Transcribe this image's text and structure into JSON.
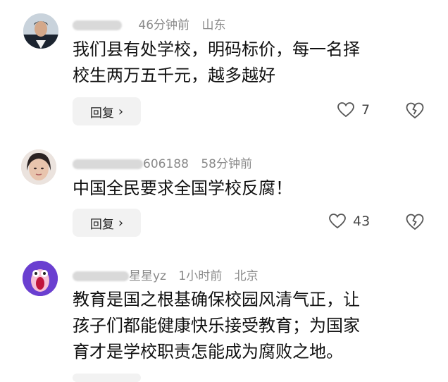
{
  "comments": [
    {
      "username": "",
      "time": "46分钟前",
      "location": "山东",
      "text_lines": [
        "我们县有处学校，明码标价，每一名择",
        "校生两万五千元，越多越好"
      ],
      "reply_label": "回复",
      "like_count": "7"
    },
    {
      "username": "606188",
      "time": "58分钟前",
      "location": "",
      "text_lines": [
        "中国全民要求全国学校反腐！"
      ],
      "reply_label": "回复",
      "like_count": "43"
    },
    {
      "username": "星星yz",
      "time": "1小时前",
      "location": "北京",
      "text_lines": [
        "教育是国之根基确保校园风清气正，让",
        "孩子们都能健康快乐接受教育；为国家",
        "育才是学校职责怎能成为腐败之地。"
      ],
      "reply_label": "",
      "like_count": ""
    }
  ],
  "icons": {
    "like": "heart-outline-icon",
    "dislike": "broken-heart-icon",
    "chevron": "chevron-right-icon"
  },
  "colors": {
    "meta_text": "#8a8a8a",
    "reply_bg": "#f2f2f2",
    "avatar3_bg": "#6a3fd0"
  }
}
